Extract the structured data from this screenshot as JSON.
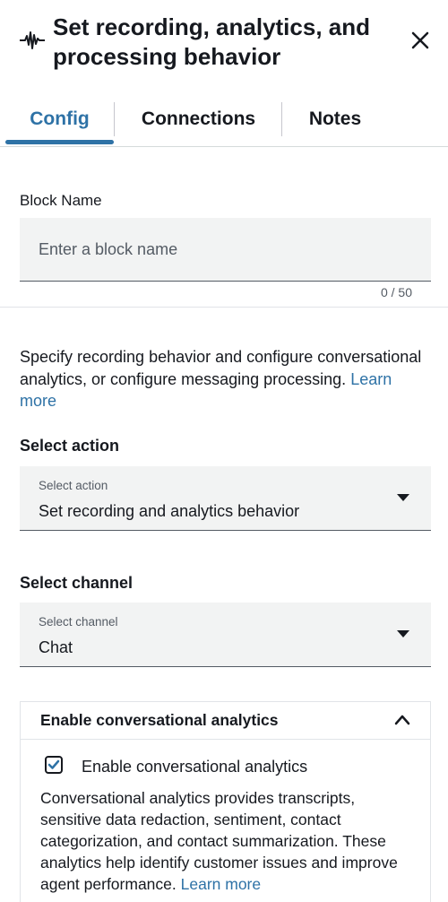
{
  "header": {
    "title": "Set recording, analytics, and processing behavior",
    "icon": "waveform-icon",
    "close_icon": "close-icon"
  },
  "tabs": [
    {
      "label": "Config",
      "active": true
    },
    {
      "label": "Connections",
      "active": false
    },
    {
      "label": "Notes",
      "active": false
    }
  ],
  "block_name": {
    "label": "Block Name",
    "placeholder": "Enter a block name",
    "value": "",
    "counter": "0 / 50"
  },
  "description": {
    "text": "Specify recording behavior and configure conversational analytics, or configure messaging processing. ",
    "link": "Learn more"
  },
  "select_action": {
    "label": "Select action",
    "small_label": "Select action",
    "value": "Set recording and analytics behavior"
  },
  "select_channel": {
    "label": "Select channel",
    "small_label": "Select channel",
    "value": "Chat"
  },
  "analytics_panel": {
    "title": "Enable conversational analytics",
    "checkbox_label": "Enable conversational analytics",
    "checked": true,
    "description": "Conversational analytics provides transcripts, sensitive data redaction, sentiment, contact categorization, and contact summarization. These analytics help identify customer issues and improve agent performance. ",
    "link": "Learn more"
  },
  "colors": {
    "accent": "#2e72a6",
    "text": "#16191f",
    "field_bg": "#f2f3f3"
  }
}
